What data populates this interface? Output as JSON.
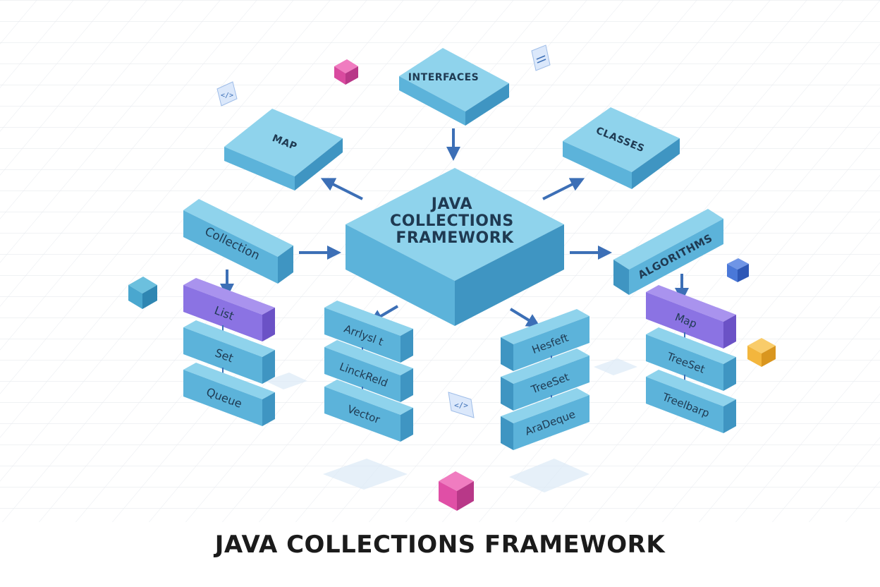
{
  "diagram": {
    "center": "JAVA\nCOLLECTIONS\nFRAMEWORK",
    "interfaces": "INTERFACES",
    "map_top": "MAP",
    "classes": "CLASSES",
    "collection": "Collection",
    "algorithms": "ALGORITHMS",
    "col1": [
      "List",
      "Set",
      "Queue"
    ],
    "col2": [
      "Arrlysl t",
      "LinckReld",
      "Vector"
    ],
    "col3": [
      "Hesfeft",
      "TreeSet",
      "AraDeque"
    ],
    "col4": [
      "Map",
      "TreeSet",
      "Treelbarp"
    ],
    "caption": "JAVA COLLECTIONS FRAMEWORK"
  },
  "colors": {
    "block_top": "#8fd3ec",
    "block_front": "#5cb3da",
    "block_side": "#3f95c2",
    "purple_top": "#a993ee",
    "purple_front": "#8b73e3",
    "arrow": "#3c6fb6",
    "grid": "#e7eaef",
    "accent_pink": "#e04fa6",
    "accent_blue": "#4a78d8",
    "accent_yellow": "#f3b63d",
    "accent_teal": "#4aa7cf"
  }
}
